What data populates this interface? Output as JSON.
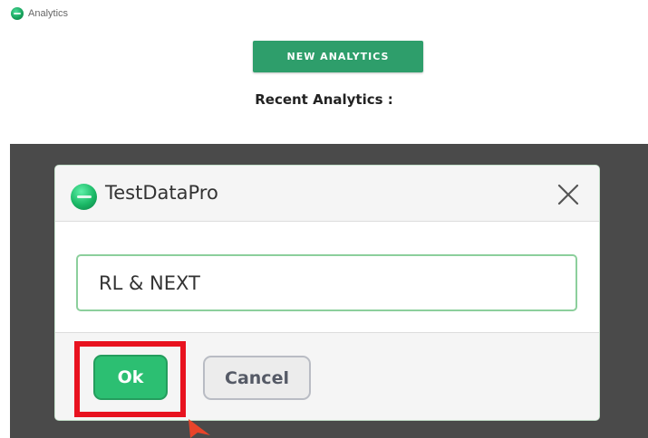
{
  "app": {
    "title": "Analytics",
    "logo_icon": "app-logo-icon"
  },
  "main": {
    "new_button_label": "NEW ANALYTICS",
    "recent_label": "Recent Analytics :"
  },
  "dialog": {
    "title": "TestDataPro",
    "input_value": "RL & NEXT",
    "ok_label": "Ok",
    "cancel_label": "Cancel",
    "close_icon": "close-icon"
  },
  "colors": {
    "brand_green": "#2e9e6b",
    "ok_green": "#2cbf72",
    "highlight_red": "#e8121f",
    "overlay": "#4a4a4a"
  }
}
